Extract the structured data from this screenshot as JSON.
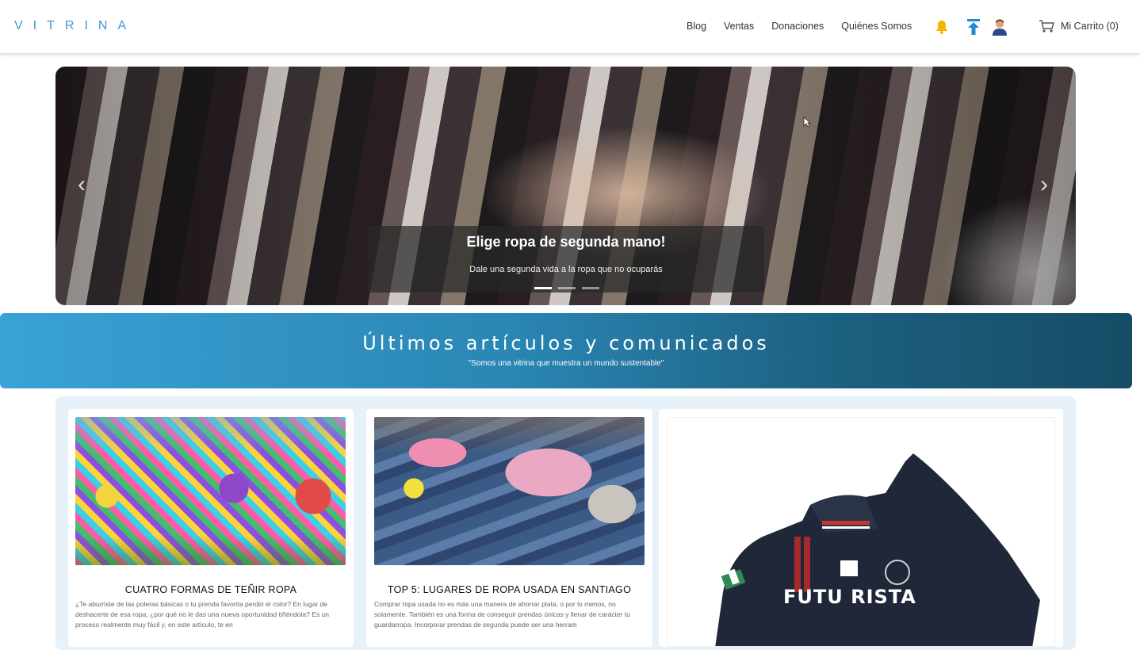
{
  "header": {
    "brand": "VITRINA",
    "nav": [
      "Blog",
      "Ventas",
      "Donaciones",
      "Quiénes Somos"
    ],
    "cart_label": "Mi Carrito (0)",
    "icons": [
      "bell-icon",
      "upload-icon",
      "user-avatar-icon",
      "cart-icon"
    ]
  },
  "hero": {
    "title": "Elige ropa de segunda mano!",
    "subtitle": "Dale una segunda vida a la ropa que no ocuparás",
    "slides": 3,
    "active_slide": 1
  },
  "section": {
    "title": "Últimos artículos y comunicados",
    "subtitle": "\"Somos una vitrina que muestra un mundo sustentable\""
  },
  "articles": [
    {
      "title": "CUATRO FORMAS DE TEÑIR ROPA",
      "excerpt": "¿Te aburriste de las poleras básicas o tu prenda favorita perdió el color? En lugar de deshacerte de esa ropa, ¿por qué no le das una nueva oportunidad tiñéndola? Es un proceso realmente muy fácil y, en este artículo, te en"
    },
    {
      "title": "TOP 5: LUGARES DE ROPA USADA EN SANTIAGO",
      "excerpt": "Comprar ropa usada no es más una manera de ahorrar plata, o por lo menos, no solamente. También es una forma de conseguir prendas únicas y llenar de carácter tu guardarropa. Incorporar prendas de segunda puede ser una herram"
    },
    {
      "title": "",
      "excerpt": "",
      "image_text": "FUTU RISTA"
    }
  ],
  "colors": {
    "brand": "#3a9ad9",
    "banner_start": "#3aa2d6",
    "banner_end": "#164c66"
  }
}
